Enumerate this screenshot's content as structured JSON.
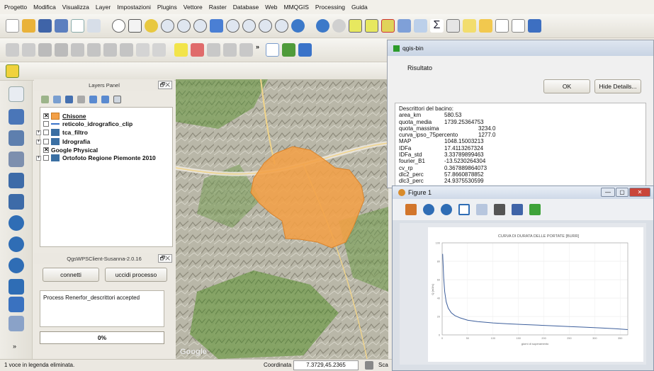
{
  "menu": [
    "Progetto",
    "Modifica",
    "Visualizza",
    "Layer",
    "Impostazioni",
    "Plugins",
    "Vettore",
    "Raster",
    "Database",
    "Web",
    "MMQGIS",
    "Processing",
    "Guida"
  ],
  "layers_panel": {
    "title": "Layers Panel",
    "layers": [
      {
        "name": "Chisone",
        "checked": true,
        "color": "#f3a047"
      },
      {
        "name": "reticolo_idrografico_clip",
        "checked": false,
        "color": "#3a73c9"
      },
      {
        "name": "tca_filtro",
        "checked": false,
        "color": "#3b6fa3"
      },
      {
        "name": "Idrografia",
        "checked": false,
        "color": "#3b6fa3"
      },
      {
        "name": "Google Physical",
        "checked": true,
        "color": ""
      },
      {
        "name": "Ortofoto Regione Piemonte 2010",
        "checked": false,
        "color": "#3b6fa3"
      }
    ]
  },
  "wps_panel": {
    "title": "QgsWPSClient-Susanna-2.0.16",
    "connect_label": "connetti",
    "kill_label": "uccidi processo",
    "message": "Process Renerfor_descrittori accepted",
    "progress_text": "0%",
    "progress": 0
  },
  "status": {
    "message": "1 voce in legenda eliminata.",
    "coord_label": "Coordinata",
    "coord_value": "7.3729,45.2365",
    "scale_label": "Sca"
  },
  "map": {
    "basemap_label": "Google"
  },
  "dialog": {
    "title": "qgis-bin",
    "subtitle": "Risultato",
    "ok_label": "OK",
    "hide_label": "Hide Details...",
    "details_header": "Descrittori del bacino:",
    "details": [
      {
        "key": "area_km",
        "value": "580.53"
      },
      {
        "key": "quota_media",
        "value": "1739.25364753"
      },
      {
        "key": "quota_massima",
        "value": "3234.0"
      },
      {
        "key": "curva_ipso_75percento",
        "value": "1277.0"
      },
      {
        "key": "MAP",
        "value": "1048.15003213"
      },
      {
        "key": "IDFa",
        "value": "17.4113267324"
      },
      {
        "key": "IDFa_std",
        "value": "3.33789899463"
      },
      {
        "key": "fourier_B1",
        "value": "-13.5230264304"
      },
      {
        "key": "cv_rp",
        "value": "0.367889864073"
      },
      {
        "key": "dlc2_perc",
        "value": "57.8660878852"
      },
      {
        "key": "dlc3_perc",
        "value": "24.9375530599"
      }
    ]
  },
  "figure": {
    "title": "Figure 1",
    "chart_title": "CURVA DI DURATA DELLE PORTATE [BURR]",
    "xlabel": "giorni di superamento",
    "ylabel": "Q [m3/s]",
    "xticks": [
      "0",
      "50",
      "100",
      "150",
      "200",
      "250",
      "300",
      "350"
    ],
    "line_color": "#3d5f9c"
  },
  "chart_data": {
    "type": "line",
    "title": "CURVA DI DURATA DELLE PORTATE [BURR]",
    "xlabel": "giorni di superamento",
    "ylabel": "Q [m3/s]",
    "xlim": [
      0,
      365
    ],
    "ylim": [
      0,
      100
    ],
    "series": [
      {
        "x": [
          1,
          3,
          5,
          8,
          12,
          18,
          25,
          35,
          50,
          70,
          100,
          130,
          160,
          190,
          220,
          250,
          280,
          310,
          340,
          365
        ],
        "values": [
          88,
          62,
          47,
          36,
          29,
          24,
          21,
          18.5,
          16,
          14.5,
          13,
          12,
          11.2,
          10.5,
          9.8,
          9.1,
          8.4,
          7.6,
          6.8,
          5.8
        ]
      }
    ],
    "yticks": [
      100,
      80,
      60,
      40,
      20,
      0
    ],
    "grid": true
  }
}
